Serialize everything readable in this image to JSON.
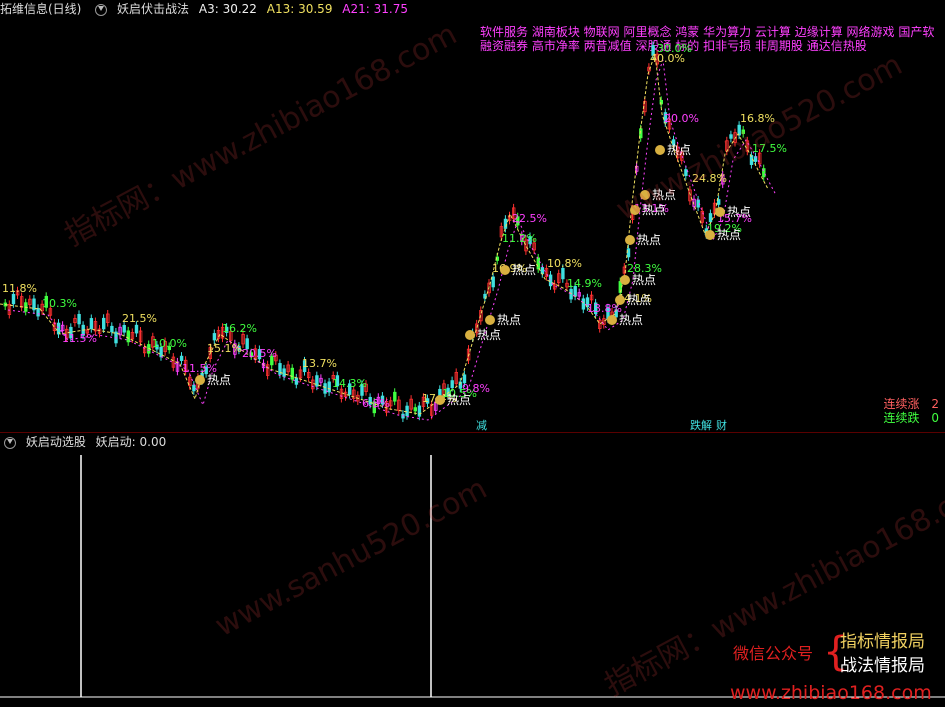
{
  "header": {
    "stock_name": "拓维信息(日线)",
    "indicator_name": "妖启伏击战法",
    "a3_label": "A3: 30.22",
    "a13_label": "A13: 30.59",
    "a21_label": "A21: 31.75"
  },
  "news": {
    "line1": "软件服务 湖南板块 物联网 阿里概念 鸿蒙 华为算力 云计算 边缘计算 网络游戏 国产软",
    "line2": "融资融券 高市净率 两昔减值 深股通 标的 扣非亏损 非周期股 通达信热股"
  },
  "annotations": {
    "pct_labels": [
      "11.8%",
      "10.3%",
      "11.5%",
      "21.5%",
      "10.0%",
      "11.5%",
      "15.1%",
      "16.2%",
      "20.5%",
      "13.7%",
      "14.3%",
      "6.8%",
      "17.4%",
      "10.5%",
      "9.8%",
      "16.9%",
      "11.2%",
      "22.5%",
      "10.8%",
      "14.9%",
      "13.8%",
      "44.1%",
      "28.3%",
      "13.1%",
      "40.0%",
      "30.0%",
      "20.0%",
      "24.8%",
      "19.2%",
      "15.7%",
      "16.8%",
      "17.5%"
    ],
    "hot_label": "热点",
    "sell_label": "减",
    "jie_label": "跌解",
    "cai_label": "财"
  },
  "stats": {
    "up_label": "连续涨",
    "up_value": "2",
    "down_label": "连续跌",
    "down_value": "0"
  },
  "lower": {
    "indicator_name": "妖启动选股",
    "value_label": "妖启动: 0.00"
  },
  "watermarks": [
    "指标网：www.zhibiao168.com",
    "www.zhibiao520.com",
    "www.sanhu520.com",
    "指标网：www.zhibiao168.com"
  ],
  "ad": {
    "wechat": "微信公众号",
    "name1": "指标情报局",
    "name2": "战法情报局",
    "url": "www.zhibiao168.com"
  },
  "colors": {
    "up": "#ff3030",
    "down": "#40e0e0",
    "magenta": "#ff40ff",
    "yellow": "#f0e060",
    "green": "#40ff40",
    "white": "#ffffff"
  }
}
